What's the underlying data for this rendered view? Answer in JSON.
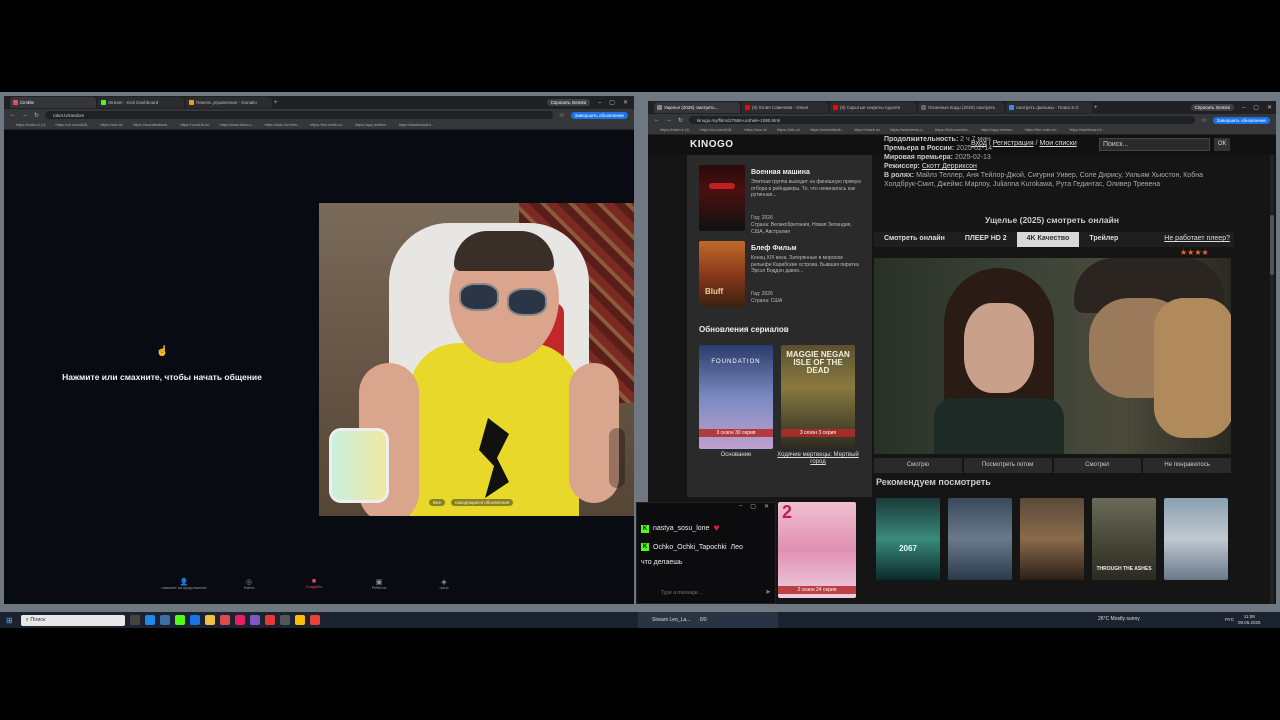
{
  "left_browser": {
    "tabs": [
      {
        "label": "Cimble",
        "active": true
      },
      {
        "label": "Stream - Kick Dashboard",
        "active": false
      },
      {
        "label": "Панель управления - Donatio",
        "active": false
      }
    ],
    "gemini_button": "Спросить Gemini",
    "url": "roket.tv/random",
    "update_button": "Завершить обновление",
    "bookmarks": [
      "https://mail.ru/ (1)",
      "https://vk.com/id18...",
      "https://ozz.ru/",
      "https://socratesbook...",
      "https://coub.bl.ru/",
      "https://www.temu.c...",
      "https://kick.com/bm...",
      "https://the-redis.ru/...",
      "https://app.restrea...",
      "https://dashboard.k..."
    ]
  },
  "chat_app": {
    "prompt": "Нажмите или смахните, чтобы начать общение",
    "nav": [
      {
        "label": "нажмите на продолжение"
      },
      {
        "label": "Найти"
      },
      {
        "label": "Создайте"
      },
      {
        "label": "Ребёнок"
      },
      {
        "label": "Чаты"
      }
    ],
    "overlay_tags": [
      "Вне",
      "находящиеся обновления"
    ]
  },
  "right_browser": {
    "tabs": [
      {
        "label": "Ущелье (2025) смотреть...",
        "active": true
      },
      {
        "label": "(8) Юлия Савичева - Юлия",
        "active": false
      },
      {
        "label": "(8) Скрытые секреты Адыгея",
        "active": false
      },
      {
        "label": "Огненные воды (2025) смотреть",
        "active": false
      },
      {
        "label": "смотреть фильмы - Поиск в G",
        "active": false
      }
    ],
    "gemini_button": "Спросить Gemini",
    "url": "kinogo.my/films/27656-ucshele-1080.html",
    "update_button": "Завершить обновление",
    "bookmarks": [
      "https://mail.ru/ (1)",
      "https://vk.com/id18...",
      "https://ozz.ru/",
      "https://vkb.ru/",
      "https://worldoftank...",
      "https://ozark.ru/",
      "https://www.temu.c...",
      "https://kick.com/bm...",
      "https://app.restrea...",
      "https://the-redis.ru/...",
      "https://dashboard.k..."
    ]
  },
  "site": {
    "logo": "KINOGO",
    "nav_login": "Вход",
    "nav_register": "Регистрация",
    "nav_lists": "Мои списки",
    "search_placeholder": "Поиск...",
    "search_button": "ОК",
    "info": {
      "duration_label": "Продолжительность:",
      "duration": "2 ч 7 мин",
      "premiere_ru_label": "Премьера в России:",
      "premiere_ru": "2025-02-14",
      "premiere_world_label": "Мировая премьера:",
      "premiere_world": "2025-02-13",
      "director_label": "Режиссер:",
      "director": "Скотт Дерриксон",
      "cast_label": "В ролях:",
      "cast": "Майлз Теллер, Аня Тейлор-Джой, Сигурни Уивер, Соле Дирису, Уильям Хьюстон, Кобна Холдбрук-Смит, Джеймс Марлоу, Julianna Kurokawa, Рута Гединтас, Оливер Тревена"
    },
    "watch_title": "Ущелье (2025) смотреть онлайн",
    "player_tabs": [
      {
        "label": "Смотреть онлайн",
        "active": false
      },
      {
        "label": "ПЛЕЕР HD 2",
        "active": false
      },
      {
        "label": "4K Качество",
        "active": true
      },
      {
        "label": "Трейлер",
        "active": false
      }
    ],
    "player_issue_link": "Не работает плеер?",
    "rating_stars": 4,
    "actions": [
      "Смотрю",
      "Посмотреть потом",
      "Смотрел",
      "Не понравилось"
    ],
    "recommend_title": "Рекомендуем посмотреть",
    "sidebar_items": [
      {
        "title": "Военная машина",
        "desc": "Элитная группа выходит на финишную прямую отбора в рейнджеры. То, что начиналось как рутинная...",
        "year": "Год: 2026",
        "countries": "Страна: Великобритания, Новая Зеландия, США, Австралия"
      },
      {
        "title": "Блеф Фильм",
        "desc": "Конец XIX века. Затерянные в морском рельефе Карибские острова. Бывшая пиратка Эрсэл Боддэн давно...",
        "year": "Год: 2026",
        "countries": "Страна: США"
      }
    ],
    "series_title": "Обновления сериалов",
    "series": [
      {
        "name": "Основание",
        "badge": "3 сезон 30 серия",
        "poster_text": "FOUNDATION"
      },
      {
        "name": "Ходячие мертвецы: Мертвый город",
        "badge": "3 сезон 3 серия",
        "poster_text": "MAGGIE NEGAN ISLE OF THE DEAD"
      },
      {
        "name": "",
        "badge": "2 сезон 24 серия",
        "poster_text": "2"
      }
    ],
    "rec_posters": [
      "2067",
      "",
      "",
      "THROUGH THE ASHES",
      ""
    ]
  },
  "chat_popup": {
    "messages": [
      {
        "user": "nastya_sosu_lone",
        "text": ""
      },
      {
        "user": "Ochko_Ochki_Tapochki",
        "text": "Лео"
      },
      {
        "user": "",
        "text": "что делаешь"
      }
    ],
    "input_placeholder": "Type a message...",
    "counter": "0/0"
  },
  "taskbar": {
    "search_placeholder": "Поиск",
    "stream_label": "Stream Leo_La...",
    "weather": "26°C  Mostly sunny",
    "lang": "РУС",
    "time": "11:08",
    "date": "09.06.2025"
  },
  "colors": {
    "accent": "#e83a3a",
    "tab_active_bg": "#d8d8d8",
    "kick_green": "#53fc18",
    "panel": "#2c2c2c"
  }
}
